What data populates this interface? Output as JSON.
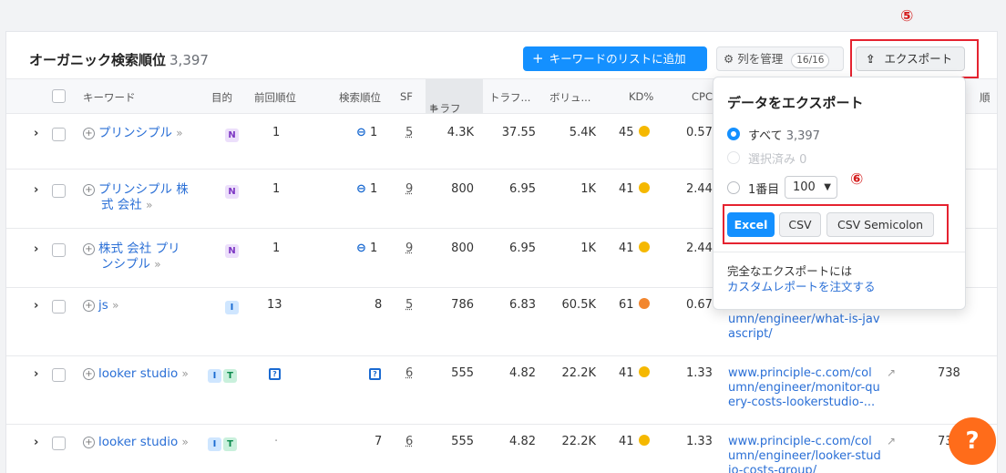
{
  "header": {
    "title": "オーガニック検索順位",
    "count": "3,397",
    "add_button": "キーワードのリストに追加",
    "manage_button": "列を管理",
    "manage_badge": "16/16",
    "export_button": "エクスポート"
  },
  "markers": {
    "m5": "⑤",
    "m6": "⑥"
  },
  "columns": [
    "キーワード",
    "目的",
    "前回順位",
    "検索順位",
    "SF",
    "トラフ",
    "トラフ...",
    "ボリュ...",
    "KD%",
    "CPC",
    "順"
  ],
  "rows": [
    {
      "keyword_l1": "プリンシプル",
      "keyword_l2": "",
      "intents": [
        "N"
      ],
      "prev": "1",
      "pos": "1",
      "sf": "5",
      "traffic": "4.3K",
      "traffic_pct": "37.55",
      "volume": "5.4K",
      "kd": "45",
      "kd_color": "#f5b800",
      "cpc": "0.57",
      "url_l1": "",
      "url_l2": "",
      "url_l3": "",
      "extra": ""
    },
    {
      "keyword_l1": "プリンシプル 株",
      "keyword_l2": "式 会社",
      "intents": [
        "N"
      ],
      "prev": "1",
      "pos": "1",
      "sf": "9",
      "traffic": "800",
      "traffic_pct": "6.95",
      "volume": "1K",
      "kd": "41",
      "kd_color": "#f5b800",
      "cpc": "2.44",
      "url_l1": "",
      "url_l2": "",
      "url_l3": "",
      "extra": ""
    },
    {
      "keyword_l1": "株式 会社 プリ",
      "keyword_l2": "ンシプル",
      "intents": [
        "N"
      ],
      "prev": "1",
      "pos": "1",
      "sf": "9",
      "traffic": "800",
      "traffic_pct": "6.95",
      "volume": "1K",
      "kd": "41",
      "kd_color": "#f5b800",
      "cpc": "2.44",
      "url_l1": "",
      "url_l2": "",
      "url_l3": "",
      "extra": ""
    },
    {
      "keyword_l1": "js",
      "keyword_l2": "",
      "intents": [
        "I"
      ],
      "prev": "13",
      "pos": "8",
      "sf": "5",
      "traffic": "786",
      "traffic_pct": "6.83",
      "volume": "60.5K",
      "kd": "61",
      "kd_color": "#f2862e",
      "cpc": "0.67",
      "url_l1": "",
      "url_l2": "umn/engineer/what-is-jav",
      "url_l3": "ascript/",
      "extra": ""
    },
    {
      "keyword_l1": "looker studio",
      "keyword_l2": "",
      "intents": [
        "I",
        "T"
      ],
      "prev": "",
      "pos": "6",
      "sf": "6",
      "traffic": "555",
      "traffic_pct": "4.82",
      "volume": "22.2K",
      "kd": "41",
      "kd_color": "#f5b800",
      "cpc": "1.33",
      "url_l1": "www.principle-c.com/col",
      "url_l2": "umn/engineer/monitor-qu",
      "url_l3": "ery-costs-lookerstudio-...",
      "extra": "738"
    },
    {
      "keyword_l1": "looker studio",
      "keyword_l2": "",
      "intents": [
        "I",
        "T"
      ],
      "prev": "·",
      "pos": "7",
      "sf": "6",
      "traffic": "555",
      "traffic_pct": "4.82",
      "volume": "22.2K",
      "kd": "41",
      "kd_color": "#f5b800",
      "cpc": "1.33",
      "url_l1": "www.principle-c.com/col",
      "url_l2": "umn/engineer/looker-stud",
      "url_l3": "io-costs-group/",
      "extra": "73"
    }
  ],
  "export_popup": {
    "title": "データをエクスポート",
    "opt_all": "すべて",
    "opt_all_count": "3,397",
    "opt_selected": "選択済み",
    "opt_selected_count": "0",
    "opt_first": "1番目",
    "first_value": "100",
    "btn_excel": "Excel",
    "btn_csv": "CSV",
    "btn_csv_semicolon": "CSV Semicolon",
    "note": "完全なエクスポートには",
    "link": "カスタムレポートを注文する"
  },
  "help": "?"
}
